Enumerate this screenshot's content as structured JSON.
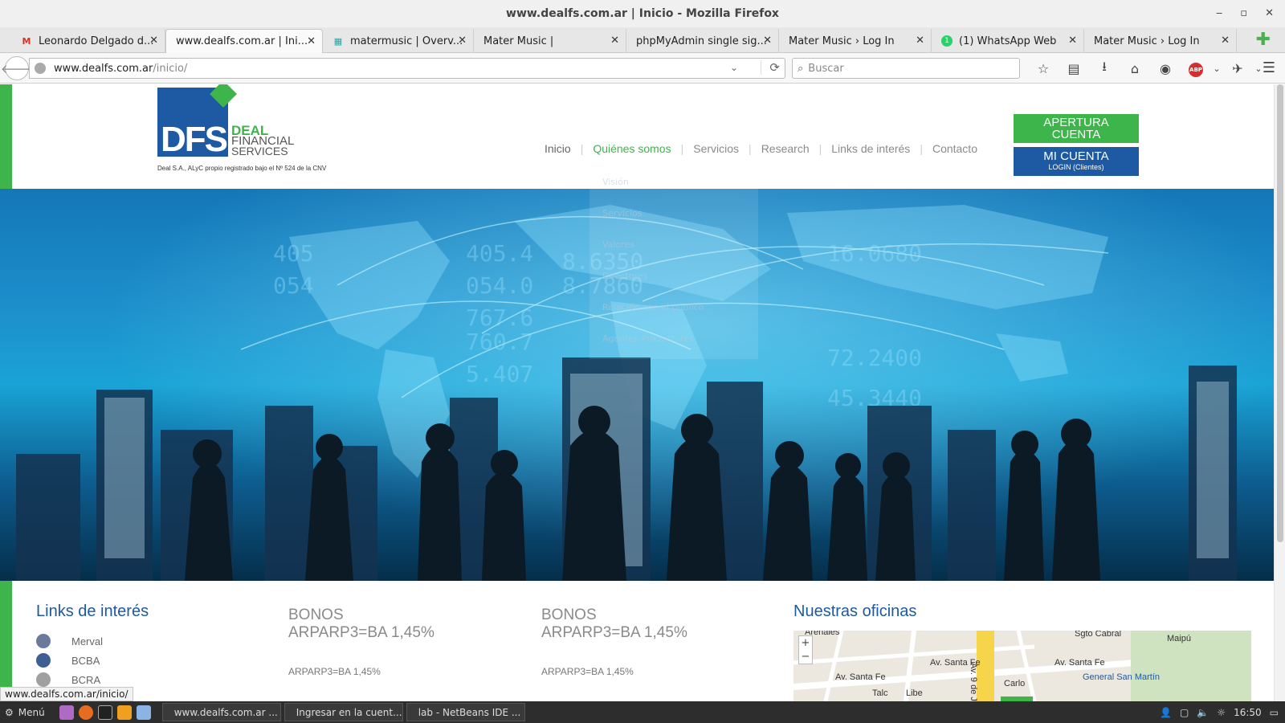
{
  "window": {
    "title": "www.dealfs.com.ar | Inicio - Mozilla Firefox",
    "controls": [
      "‒",
      "▫",
      "✕"
    ]
  },
  "tabs": [
    {
      "label": "Leonardo Delgado d...",
      "icon": "gmail-icon"
    },
    {
      "label": "www.dealfs.com.ar | Ini...",
      "icon": "none",
      "active": true
    },
    {
      "label": "matermusic | Overv...",
      "icon": "grid-icon"
    },
    {
      "label": "Mater Music |",
      "icon": "none"
    },
    {
      "label": "phpMyAdmin single sig...",
      "icon": "none"
    },
    {
      "label": "Mater Music › Log In",
      "icon": "none"
    },
    {
      "label": "(1) WhatsApp Web",
      "icon": "whatsapp-icon"
    },
    {
      "label": "Mater Music › Log In",
      "icon": "none"
    }
  ],
  "toolbar": {
    "url_host": "www.dealfs.com.ar",
    "url_path": "/inicio/",
    "search_placeholder": "Buscar"
  },
  "site": {
    "logo": {
      "dfs": "DFS",
      "deal": "DEAL",
      "financial": "FINANCIAL",
      "services": "SERVICES",
      "subtitle": "Deal S.A., ALyC propio registrado bajo el Nº 524 de la CNV"
    },
    "nav": [
      "Inicio",
      "Quiénes somos",
      "Servicios",
      "Research",
      "Links de interés",
      "Contacto"
    ],
    "dropdown": [
      "Visión",
      "Servicios",
      "Valores",
      "Directores",
      "Relación con el público",
      "Agentes Productores"
    ],
    "btn_apertura_1": "APERTURA",
    "btn_apertura_2": "CUENTA",
    "btn_micuenta_big": "MI CUENTA",
    "btn_micuenta_small": "LOGIN (Clientes)"
  },
  "content": {
    "links_title": "Links de interés",
    "links": [
      "Merval",
      "BCBA",
      "BCRA"
    ],
    "bonos1_title": "BONOS",
    "bonos1_value": "ARPARP3=BA 1,45%",
    "bonos1_small": "ARPARP3=BA 1,45%",
    "bonos2_title": "BONOS",
    "bonos2_value": "ARPARP3=BA 1,45%",
    "bonos2_small": "ARPARP3=BA 1,45%",
    "oficinas_title": "Nuestras oficinas",
    "map_labels": [
      "Arenales",
      "Sgto Cabral",
      "Av. Santa Fe",
      "Av. Santa Fe",
      "Av. Santa Fe",
      "Av. 9 de Julio",
      "General San Martín",
      "Libe",
      "Talc",
      "Carlo",
      "Maipú"
    ]
  },
  "status_link": "www.dealfs.com.ar/inicio/",
  "taskbar": {
    "menu": "Menú",
    "tasks": [
      "www.dealfs.com.ar ...",
      "Ingresar en la cuent...",
      "lab - NetBeans IDE ..."
    ],
    "clock": "16:50"
  }
}
